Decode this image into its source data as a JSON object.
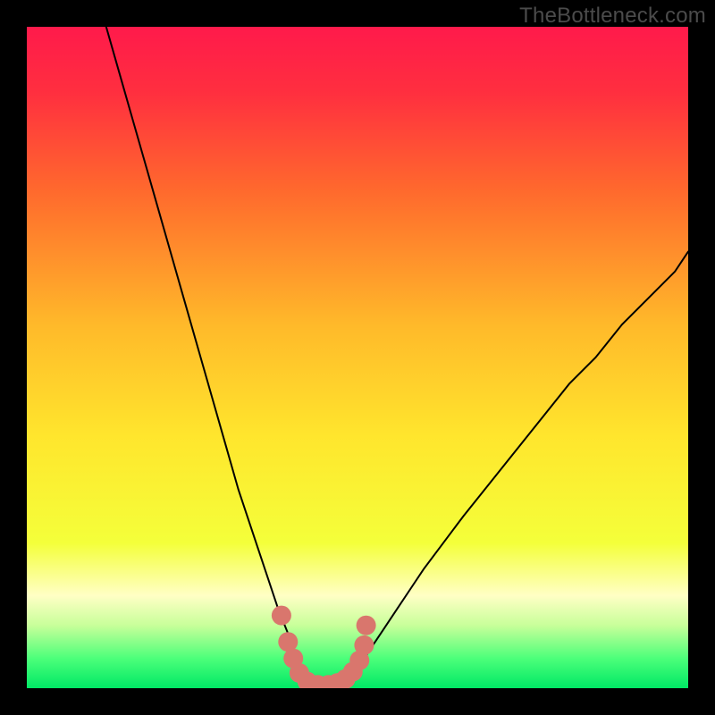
{
  "watermark": {
    "text": "TheBottleneck.com"
  },
  "chart_data": {
    "type": "line",
    "title": "",
    "xlabel": "",
    "ylabel": "",
    "xlim": [
      0,
      100
    ],
    "ylim": [
      0,
      100
    ],
    "background_gradient": {
      "stops": [
        {
          "offset": 0.0,
          "color": "#ff1a4b"
        },
        {
          "offset": 0.1,
          "color": "#ff2f3f"
        },
        {
          "offset": 0.25,
          "color": "#ff6a2d"
        },
        {
          "offset": 0.45,
          "color": "#ffb92a"
        },
        {
          "offset": 0.62,
          "color": "#ffe62d"
        },
        {
          "offset": 0.78,
          "color": "#f4ff3a"
        },
        {
          "offset": 0.86,
          "color": "#ffffc5"
        },
        {
          "offset": 0.905,
          "color": "#c8ff9a"
        },
        {
          "offset": 0.955,
          "color": "#4cff7a"
        },
        {
          "offset": 1.0,
          "color": "#00e865"
        }
      ]
    },
    "series": [
      {
        "name": "left-curve",
        "x": [
          12,
          14,
          16,
          18,
          20,
          22,
          24,
          26,
          28,
          30,
          32,
          34,
          36,
          38,
          40,
          41,
          42,
          43
        ],
        "y": [
          100,
          93,
          86,
          79,
          72,
          65,
          58,
          51,
          44,
          37,
          30,
          24,
          18,
          12,
          7,
          4,
          2,
          1
        ],
        "color": "#000000",
        "width": 2
      },
      {
        "name": "right-curve",
        "x": [
          48,
          49,
          50,
          52,
          54,
          56,
          58,
          60,
          63,
          66,
          70,
          74,
          78,
          82,
          86,
          90,
          94,
          98,
          100
        ],
        "y": [
          1,
          2,
          3,
          6,
          9,
          12,
          15,
          18,
          22,
          26,
          31,
          36,
          41,
          46,
          50,
          55,
          59,
          63,
          66
        ],
        "color": "#000000",
        "width": 2
      },
      {
        "name": "valley-floor",
        "x": [
          43,
          44,
          45,
          46,
          47,
          48
        ],
        "y": [
          1,
          0.5,
          0.3,
          0.3,
          0.5,
          1
        ],
        "color": "#000000",
        "width": 2
      }
    ],
    "markers": {
      "name": "highlight-valley",
      "color": "#d9766d",
      "radius": 11,
      "points": [
        {
          "x": 38.5,
          "y": 11
        },
        {
          "x": 39.5,
          "y": 7
        },
        {
          "x": 40.3,
          "y": 4.5
        },
        {
          "x": 41.2,
          "y": 2.3
        },
        {
          "x": 42.4,
          "y": 1.0
        },
        {
          "x": 44.0,
          "y": 0.5
        },
        {
          "x": 45.6,
          "y": 0.5
        },
        {
          "x": 47.0,
          "y": 0.8
        },
        {
          "x": 48.2,
          "y": 1.4
        },
        {
          "x": 49.3,
          "y": 2.5
        },
        {
          "x": 50.3,
          "y": 4.2
        },
        {
          "x": 51.0,
          "y": 6.5
        },
        {
          "x": 51.3,
          "y": 9.5
        }
      ]
    }
  }
}
